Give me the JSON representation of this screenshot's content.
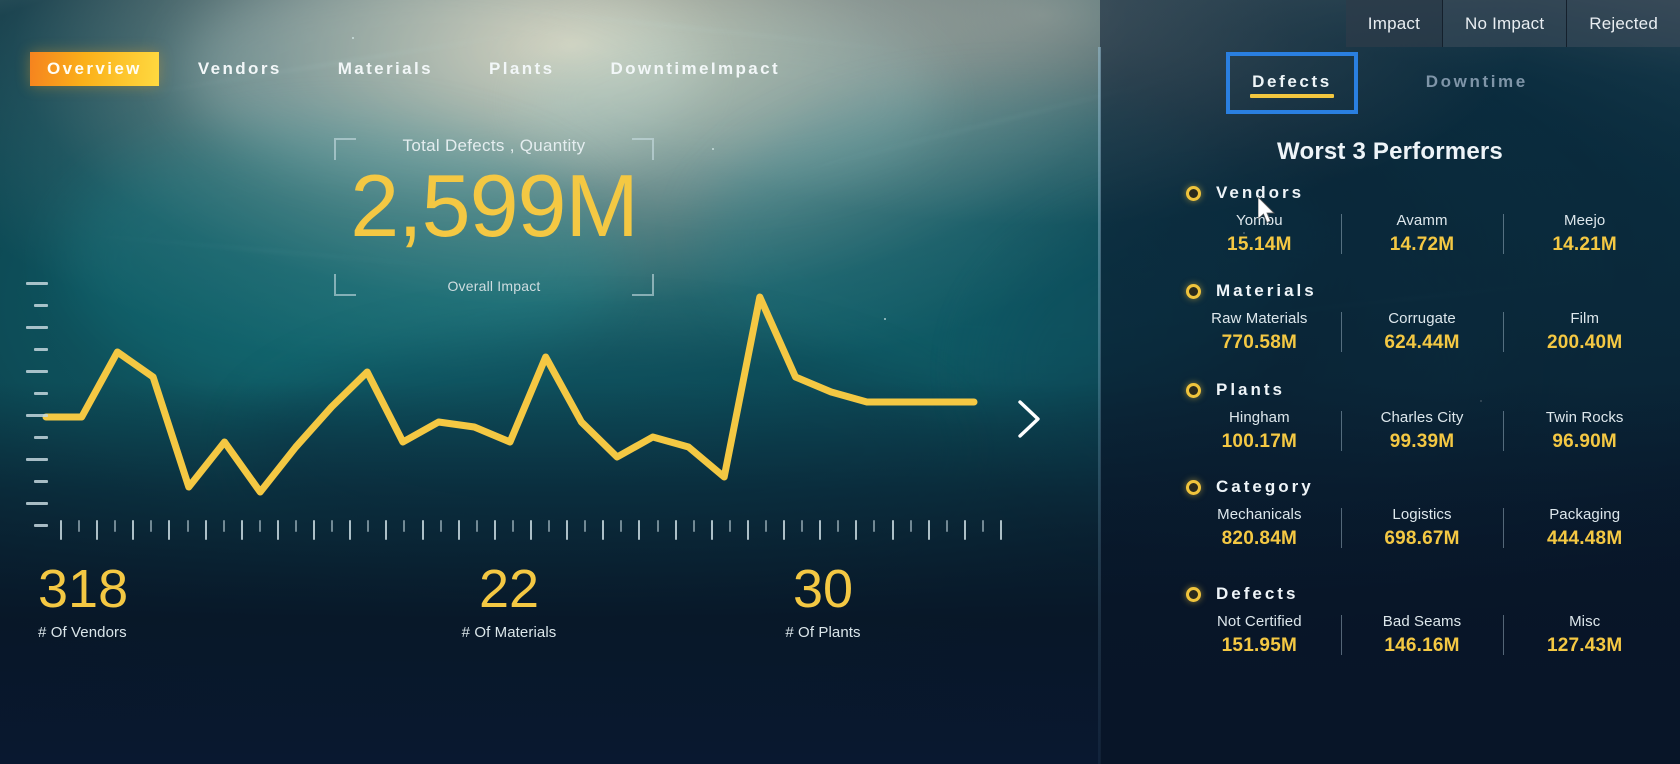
{
  "topbar": {
    "buttons": [
      {
        "label": "Impact",
        "active": true
      },
      {
        "label": "No Impact",
        "active": false
      },
      {
        "label": "Rejected",
        "active": false
      }
    ]
  },
  "nav": {
    "tabs": [
      {
        "label": "Overview",
        "active": true
      },
      {
        "label": "Vendors",
        "active": false
      },
      {
        "label": "Materials",
        "active": false
      },
      {
        "label": "Plants",
        "active": false
      },
      {
        "label": "DowntimeImpact",
        "active": false
      }
    ]
  },
  "kpi_card": {
    "title": "Total Defects , Quantity",
    "value": "2,599M",
    "subtitle": "Overall Impact"
  },
  "bottom_kpis": [
    {
      "value": "318",
      "label": "# Of Vendors"
    },
    {
      "value": "22",
      "label": "# Of Materials"
    },
    {
      "value": "30",
      "label": "# Of Plants"
    }
  ],
  "chart_nav": {
    "next_icon": "chevron-right-icon"
  },
  "right_panel": {
    "tabs": [
      {
        "label": "Defects",
        "active": true,
        "focused": true
      },
      {
        "label": "Downtime",
        "active": false,
        "focused": false
      }
    ],
    "heading": "Worst 3 Performers",
    "groups": [
      {
        "title": "Vendors",
        "items": [
          {
            "name": "Yombu",
            "value": "15.14M"
          },
          {
            "name": "Avamm",
            "value": "14.72M"
          },
          {
            "name": "Meejo",
            "value": "14.21M"
          }
        ]
      },
      {
        "title": "Materials",
        "items": [
          {
            "name": "Raw Materials",
            "value": "770.58M"
          },
          {
            "name": "Corrugate",
            "value": "624.44M"
          },
          {
            "name": "Film",
            "value": "200.40M"
          }
        ]
      },
      {
        "title": "Plants",
        "items": [
          {
            "name": "Hingham",
            "value": "100.17M"
          },
          {
            "name": "Charles City",
            "value": "99.39M"
          },
          {
            "name": "Twin Rocks",
            "value": "96.90M"
          }
        ]
      },
      {
        "title": "Category",
        "items": [
          {
            "name": "Mechanicals",
            "value": "820.84M"
          },
          {
            "name": "Logistics",
            "value": "698.67M"
          },
          {
            "name": "Packaging",
            "value": "444.48M"
          }
        ]
      },
      {
        "title": "Defects",
        "items": [
          {
            "name": "Not Certified",
            "value": "151.95M"
          },
          {
            "name": "Bad Seams",
            "value": "146.16M"
          },
          {
            "name": "Misc",
            "value": "127.43M"
          }
        ]
      }
    ]
  },
  "colors": {
    "accent_yellow": "#f4c843",
    "accent_orange": "#f5831f",
    "focus_blue": "#2a7fe0",
    "panel_bg": "#0a1c32",
    "text_light": "#eef4f8"
  },
  "chart_data": {
    "type": "line",
    "title": "",
    "xlabel": "",
    "ylabel": "",
    "grid": false,
    "legend": "none",
    "series": [
      {
        "name": "Total Defects Quantity",
        "color": "#f4c843",
        "x": [
          0,
          1,
          2,
          3,
          4,
          5,
          6,
          7,
          8,
          9,
          10,
          11,
          12,
          13,
          14,
          15,
          16,
          17,
          18,
          19,
          20,
          21,
          22,
          23,
          24,
          25,
          26
        ],
        "values": [
          46,
          46,
          72,
          62,
          18,
          36,
          16,
          34,
          50,
          64,
          36,
          44,
          42,
          36,
          70,
          44,
          30,
          38,
          34,
          22,
          94,
          62,
          56,
          52,
          52,
          52,
          52
        ]
      }
    ],
    "ylim": [
      0,
      100
    ],
    "xlim": [
      0,
      26
    ],
    "yticks_labeled": false,
    "xticks_labeled": false
  }
}
